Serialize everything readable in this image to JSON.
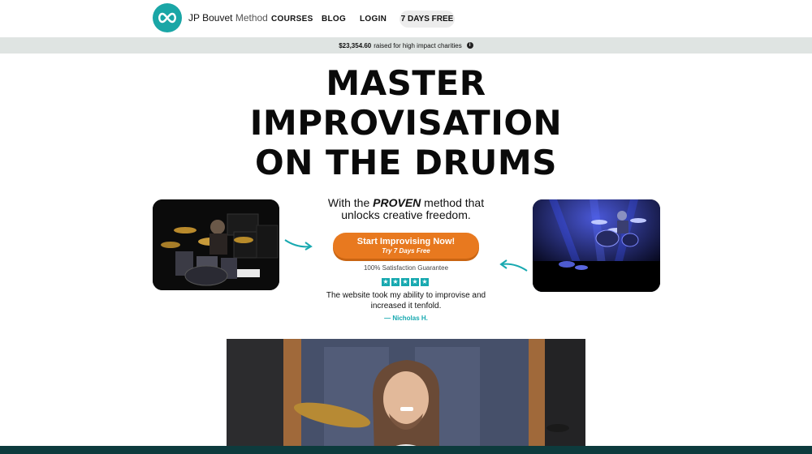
{
  "header": {
    "brand_name": "JP Bouvet",
    "brand_suffix": "Method",
    "nav": [
      {
        "label": "COURSES"
      },
      {
        "label": "BLOG"
      },
      {
        "label": "LOGIN"
      }
    ],
    "cta_label": "7 DAYS FREE"
  },
  "charity_bar": {
    "amount": "$23,354.60",
    "text": "raised for high impact charities"
  },
  "hero": {
    "headline_line1": "MASTER",
    "headline_line2": "IMPROVISATION",
    "headline_line3": "ON THE DRUMS",
    "sub_prefix": "With the ",
    "sub_emphasis": "PROVEN",
    "sub_suffix": " method that unlocks creative freedom.",
    "cta_line1": "Start Improvising Now!",
    "cta_line2": "Try 7 Days Free",
    "guarantee": "100% Satisfaction Guarantee",
    "rating_stars": 5,
    "testimonial": "The website took my ability to improvise and increased it tenfold.",
    "testimonial_author": "— Nicholas H."
  },
  "colors": {
    "accent_teal": "#18a9b0",
    "cta_orange": "#e8791f",
    "charity_bar_bg": "#dfe4e2"
  },
  "icons": {
    "logo": "infinity-logo-icon",
    "info": "info-icon",
    "star": "star-icon",
    "arrow": "curved-arrow-icon"
  }
}
